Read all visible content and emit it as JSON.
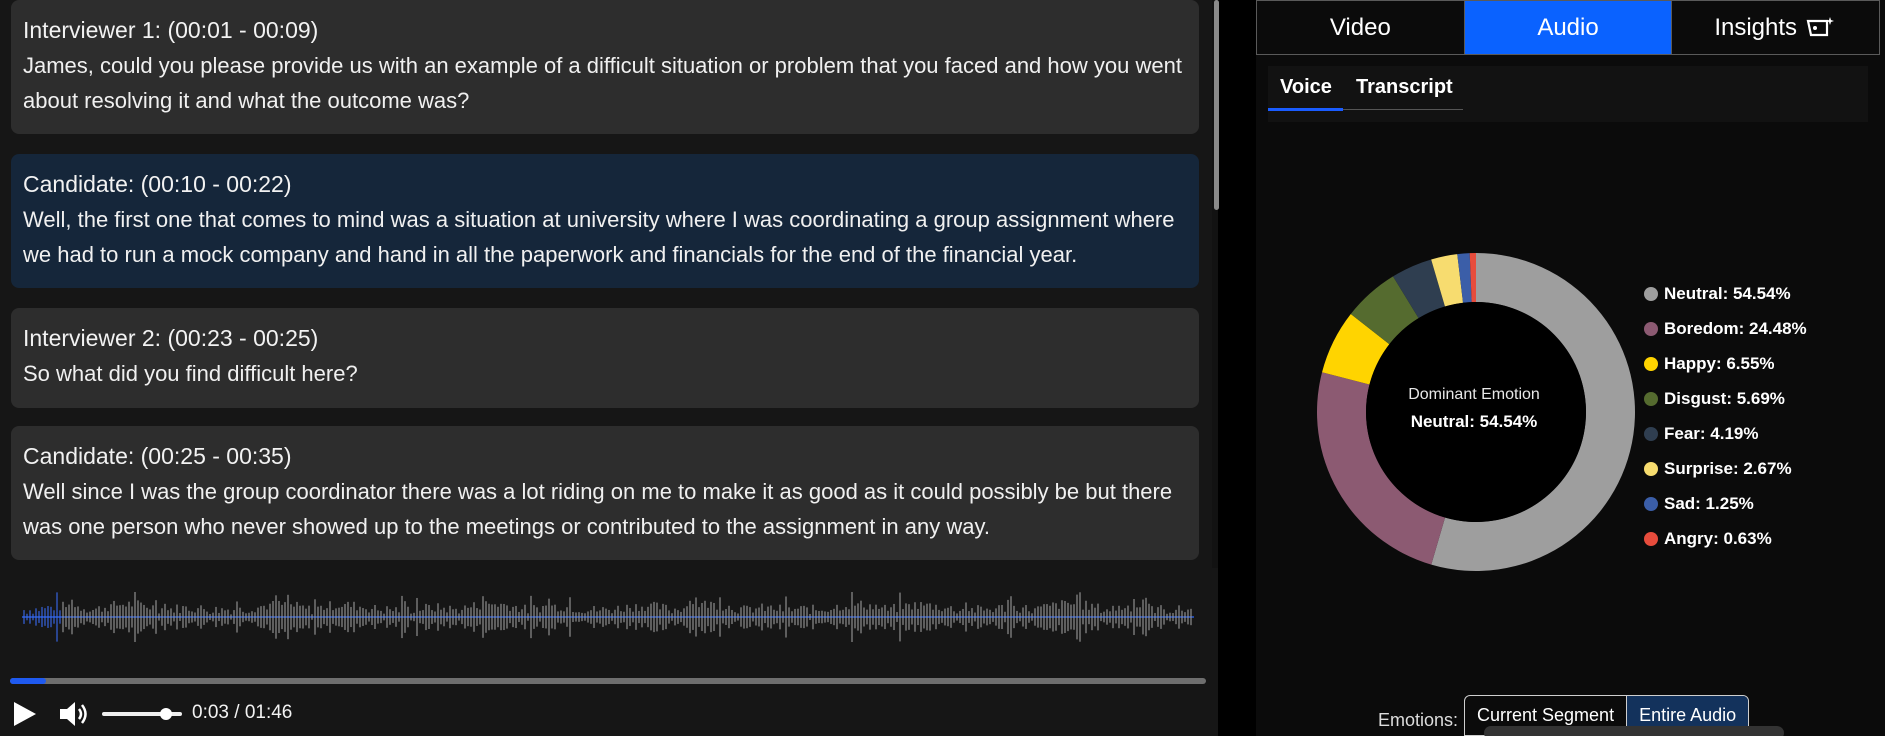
{
  "transcript": {
    "segments": [
      {
        "speaker": "Interviewer 1: (00:01 - 00:09)",
        "text": "James, could you please provide us with an example of a difficult situation or problem that you faced and how you went about resolving it and what the outcome was?"
      },
      {
        "speaker": "Candidate: (00:10 - 00:22)",
        "text": "Well, the first one that comes to mind was a situation at university where I was coordinating a group assignment where we had to run a mock company and hand in all the paperwork and financials for the end of the financial year."
      },
      {
        "speaker": "Interviewer 2: (00:23 - 00:25)",
        "text": "So what did you find difficult here?"
      },
      {
        "speaker": "Candidate: (00:25 - 00:35)",
        "text": "Well since I was the group coordinator there was a lot riding on me to make it as good as it could possibly be but there was one person who never showed up to the meetings or contributed to the assignment in any way."
      }
    ]
  },
  "player": {
    "time": "0:03 / 01:46",
    "progress": 0.03,
    "volume": 0.8,
    "play_icon": "play-icon",
    "volume_icon": "volume-icon",
    "played_color": "#1f5af0"
  },
  "tabs": {
    "video": "Video",
    "audio": "Audio",
    "insights": "Insights",
    "active": "Audio",
    "insights_icon": "sparkle-tag-icon"
  },
  "subtabs": {
    "voice": "Voice",
    "transcript": "Transcript",
    "active": "Voice"
  },
  "chart_data": {
    "type": "pie",
    "donut": true,
    "center_title": "Dominant Emotion",
    "center_value": "Neutral: 54.54%",
    "slices": [
      {
        "label": "Neutral: 54.54%",
        "name": "Neutral",
        "value": 54.54,
        "color": "#9e9e9e"
      },
      {
        "label": "Boredom: 24.48%",
        "name": "Boredom",
        "value": 24.48,
        "color": "#8c5a72"
      },
      {
        "label": "Happy: 6.55%",
        "name": "Happy",
        "value": 6.55,
        "color": "#ffd400"
      },
      {
        "label": "Disgust: 5.69%",
        "name": "Disgust",
        "value": 5.69,
        "color": "#556b2f"
      },
      {
        "label": "Fear: 4.19%",
        "name": "Fear",
        "value": 4.19,
        "color": "#2f3e50"
      },
      {
        "label": "Surprise: 2.67%",
        "name": "Surprise",
        "value": 2.67,
        "color": "#f7dc6f"
      },
      {
        "label": "Sad: 1.25%",
        "name": "Sad",
        "value": 1.25,
        "color": "#3b5ea8"
      },
      {
        "label": "Angry: 0.63%",
        "name": "Angry",
        "value": 0.63,
        "color": "#e74c3c"
      }
    ],
    "legend_position": "right"
  },
  "emotions_toggle": {
    "label": "Emotions:",
    "current": "Current Segment",
    "entire": "Entire Audio",
    "active": "Entire Audio"
  }
}
